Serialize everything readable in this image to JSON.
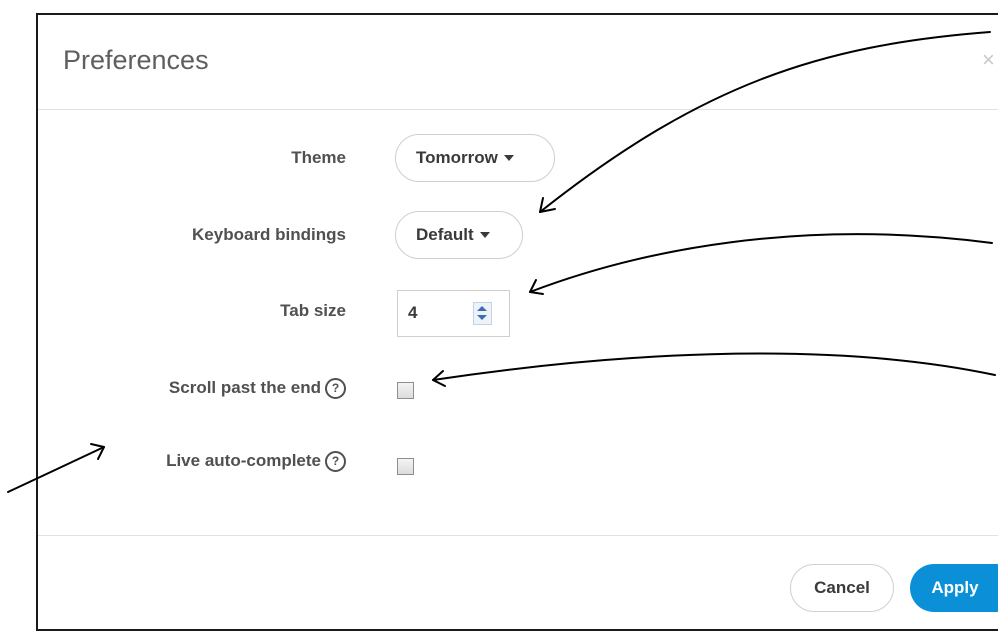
{
  "dialog": {
    "title": "Preferences",
    "close_symbol": "×"
  },
  "fields": {
    "theme": {
      "label": "Theme",
      "value": "Tomorrow"
    },
    "keyboard": {
      "label": "Keyboard bindings",
      "value": "Default"
    },
    "tab_size": {
      "label": "Tab size",
      "value": "4"
    },
    "scroll_past_end": {
      "label": "Scroll past the end",
      "help": "?",
      "checked": false
    },
    "live_autocomplete": {
      "label": "Live auto-complete",
      "help": "?",
      "checked": false
    }
  },
  "footer": {
    "cancel_label": "Cancel",
    "apply_label": "Apply"
  },
  "colors": {
    "accent": "#0b90d8",
    "label_text": "#505050",
    "title_text": "#5f5f5f"
  },
  "icons": [
    "close-icon",
    "help-icon",
    "caret-down-icon",
    "spinner-icon",
    "annotation-arrow"
  ]
}
